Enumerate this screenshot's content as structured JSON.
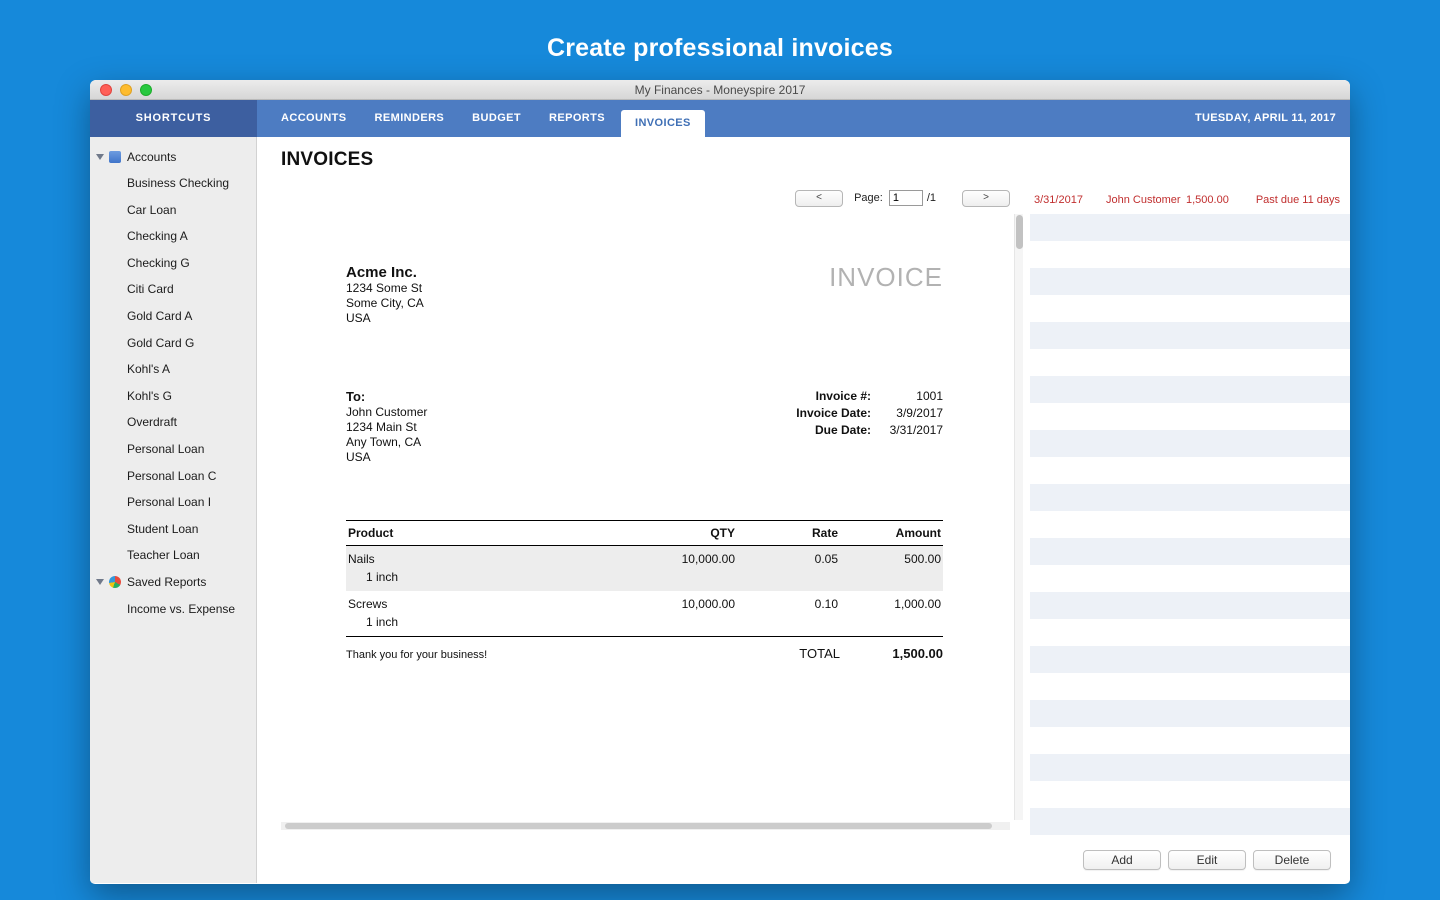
{
  "page": {
    "headline": "Create professional invoices"
  },
  "window": {
    "title": "My Finances - Moneyspire 2017"
  },
  "nav": {
    "shortcuts_label": "SHORTCUTS",
    "tabs": [
      {
        "label": "ACCOUNTS",
        "active": false
      },
      {
        "label": "REMINDERS",
        "active": false
      },
      {
        "label": "BUDGET",
        "active": false
      },
      {
        "label": "REPORTS",
        "active": false
      },
      {
        "label": "INVOICES",
        "active": true
      }
    ],
    "date": "TUESDAY, APRIL 11, 2017"
  },
  "sidebar": {
    "accounts_label": "Accounts",
    "accounts": [
      "Business Checking",
      "Car Loan",
      "Checking A",
      "Checking G",
      "Citi Card",
      "Gold Card A",
      "Gold Card G",
      "Kohl's A",
      "Kohl's G",
      "Overdraft",
      "Personal Loan",
      "Personal Loan C",
      "Personal Loan I",
      "Student Loan",
      "Teacher Loan"
    ],
    "saved_reports_label": "Saved Reports",
    "reports": [
      "Income vs. Expense"
    ]
  },
  "main": {
    "title": "INVOICES",
    "pagination": {
      "prev": "<",
      "page_label": "Page:",
      "page_value": "1",
      "total": "/1",
      "next": ">"
    }
  },
  "invoice": {
    "company": {
      "name": "Acme Inc.",
      "address": [
        "1234 Some St",
        "Some City, CA",
        "USA"
      ]
    },
    "watermark": "INVOICE",
    "to_label": "To:",
    "recipient": [
      "John Customer",
      "1234 Main St",
      "Any Town, CA",
      "USA"
    ],
    "meta": [
      {
        "label": "Invoice #:",
        "value": "1001"
      },
      {
        "label": "Invoice Date:",
        "value": "3/9/2017"
      },
      {
        "label": "Due Date:",
        "value": "3/31/2017"
      }
    ],
    "table": {
      "headers": [
        "Product",
        "QTY",
        "Rate",
        "Amount"
      ],
      "rows": [
        {
          "product": "Nails",
          "detail": "1 inch",
          "qty": "10,000.00",
          "rate": "0.05",
          "amount": "500.00"
        },
        {
          "product": "Screws",
          "detail": "1 inch",
          "qty": "10,000.00",
          "rate": "0.10",
          "amount": "1,000.00"
        }
      ]
    },
    "footer": {
      "message": "Thank you for your business!",
      "total_label": "TOTAL",
      "total_value": "1,500.00"
    }
  },
  "invoice_list": {
    "rows": [
      {
        "date": "3/31/2017",
        "customer": "John Customer",
        "amount": "1,500.00",
        "status": "Past due 11 days",
        "overdue": true
      }
    ],
    "empty_row_count": 23
  },
  "actions": {
    "add": "Add",
    "edit": "Edit",
    "delete": "Delete"
  },
  "colors": {
    "background_blue": "#1689da",
    "nav_blue": "#4d7cc2",
    "shortcuts_blue": "#3d5fa0",
    "overdue_red": "#c12f2f",
    "stripe": "#edf1f7"
  }
}
